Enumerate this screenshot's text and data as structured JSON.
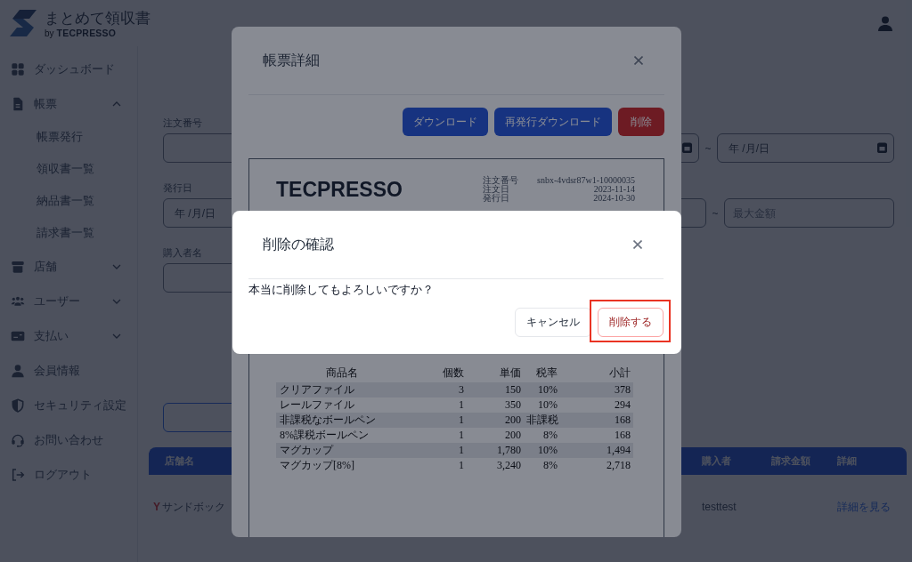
{
  "header": {
    "brand": {
      "name": "まとめて領収書",
      "by": "by",
      "company": "TECPRESSO"
    }
  },
  "sidebar": {
    "items": [
      {
        "kind": "link",
        "label": "ダッシュボード"
      },
      {
        "kind": "group",
        "label": "帳票",
        "expanded": true,
        "children": [
          {
            "label": "帳票発行"
          },
          {
            "label": "領収書一覧"
          },
          {
            "label": "納品書一覧"
          },
          {
            "label": "請求書一覧"
          }
        ]
      },
      {
        "kind": "group",
        "label": "店舗",
        "expanded": false
      },
      {
        "kind": "group",
        "label": "ユーザー",
        "expanded": false
      },
      {
        "kind": "group",
        "label": "支払い",
        "expanded": false
      },
      {
        "kind": "link",
        "label": "会員情報"
      },
      {
        "kind": "link",
        "label": "セキュリティ設定"
      },
      {
        "kind": "link",
        "label": "お問い合わせ"
      },
      {
        "kind": "link",
        "label": "ログアウト"
      }
    ]
  },
  "search_form": {
    "rows": [
      {
        "field": {
          "label": "注文番号",
          "kind": "text"
        },
        "range": {
          "from": {
            "kind": "date"
          },
          "separator": "~",
          "to": {
            "kind": "date",
            "placeholder": "年 /月/日"
          }
        }
      },
      {
        "field": {
          "label": "発行日",
          "kind": "date",
          "placeholder": "年 /月/日"
        },
        "range": {
          "from": {
            "kind": "number"
          },
          "separator": "~",
          "to": {
            "kind": "number",
            "placeholder": "最大金額"
          }
        }
      },
      {
        "field": {
          "label": "購入者名",
          "kind": "text"
        }
      }
    ]
  },
  "results_table": {
    "columns": [
      "店舗名",
      "購入者",
      "請求金額",
      "詳細"
    ],
    "rows": [
      {
        "store_mark": "Y",
        "store": "サンドボック",
        "buyer": "testtest",
        "detail_link": "詳細を見る"
      }
    ]
  },
  "detail_modal": {
    "title": "帳票詳細",
    "buttons": [
      {
        "label": "ダウンロード",
        "kind": "primary"
      },
      {
        "label": "再発行ダウンロード",
        "kind": "primary"
      },
      {
        "label": "削除",
        "kind": "danger"
      }
    ],
    "document": {
      "logo": "TECPRESSO",
      "meta": [
        {
          "label": "注文番号",
          "value": "snbx-4vdsr87w1-10000035"
        },
        {
          "label": "注文日",
          "value": "2023-11-14"
        },
        {
          "label": "発行日",
          "value": "2024-10-30"
        }
      ],
      "table": {
        "columns": [
          "商品名",
          "個数",
          "単価",
          "税率",
          "小計"
        ],
        "rows": [
          [
            "クリアファイル",
            "3",
            "150",
            "10%",
            "378"
          ],
          [
            "レールファイル",
            "1",
            "350",
            "10%",
            "294"
          ],
          [
            "非課税なボールペン",
            "1",
            "200",
            "非課税",
            "168"
          ],
          [
            "8%課税ボールペン",
            "1",
            "200",
            "8%",
            "168"
          ],
          [
            "マグカップ",
            "1",
            "1,780",
            "10%",
            "1,494"
          ],
          [
            "マグカップ[8%]",
            "1",
            "3,240",
            "8%",
            "2,718"
          ]
        ]
      }
    }
  },
  "confirm_dialog": {
    "title": "削除の確認",
    "message": "本当に削除してもよろしいですか？",
    "buttons": [
      {
        "label": "キャンセル",
        "kind": "secondary",
        "highlighted": false
      },
      {
        "label": "削除する",
        "kind": "danger",
        "highlighted": true
      }
    ]
  }
}
